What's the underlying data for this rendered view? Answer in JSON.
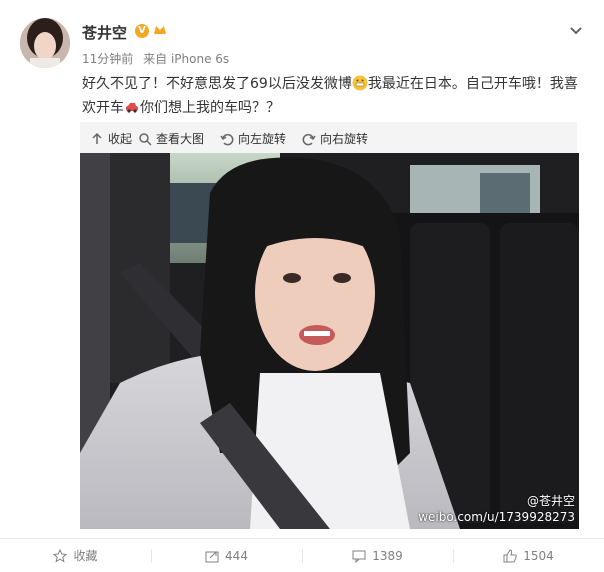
{
  "post": {
    "author": "苍井空",
    "time": "11分钟前",
    "source_prefix": "来自",
    "source": "iPhone 6s",
    "text_before_emoji": "好久不见了！不好意思发了69以后没发微博",
    "text_middle": "我最近在日本。自己开车哦！我喜欢开车",
    "text_after": "你们想上我的车吗？？"
  },
  "media_toolbar": {
    "collapse": "收起",
    "view_large": "查看大图",
    "rotate_left": "向左旋转",
    "rotate_right": "向右旋转"
  },
  "photo": {
    "watermark_handle": "@苍井空",
    "watermark_url": "weibo.com/u/1739928273"
  },
  "actions": {
    "favorite": "收藏",
    "repost": "444",
    "comment": "1389",
    "like": "1504"
  },
  "colors": {
    "accent": "#f5a623",
    "link": "#eb7350",
    "text": "#333333",
    "muted": "#808080"
  }
}
